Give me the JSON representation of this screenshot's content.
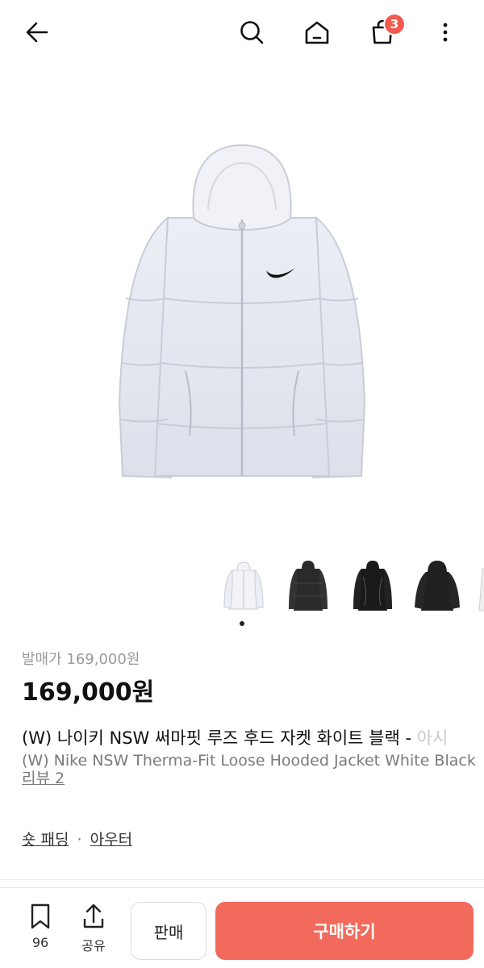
{
  "header": {
    "cart_count": "3"
  },
  "product": {
    "release_price_label": "발매가 169,000원",
    "price": "169,000원",
    "title_ko": "(W) 나이키 NSW 써마핏 루즈 후드 자켓 화이트 블랙 - ",
    "title_ko_overflow": "아시",
    "title_en": "(W) Nike NSW Therma-Fit Loose Hooded Jacket White Black",
    "review_label": "리뷰 2",
    "category_1": "숏 패딩",
    "category_sep": "·",
    "category_2": "아우터"
  },
  "thumbnails": [
    {
      "name": "white",
      "color": "#f2f3f7"
    },
    {
      "name": "black-matte",
      "color": "#2a2a2a"
    },
    {
      "name": "black-gloss",
      "color": "#1a1a1a"
    },
    {
      "name": "black-hooded",
      "color": "#202020"
    },
    {
      "name": "white-partial",
      "color": "#eeeeee"
    }
  ],
  "bottom": {
    "bookmark_count": "96",
    "share_label": "공유",
    "sell_label": "판매",
    "buy_label": "구매하기"
  },
  "colors": {
    "accent": "#f26a5c",
    "badge": "#f25a4e"
  }
}
